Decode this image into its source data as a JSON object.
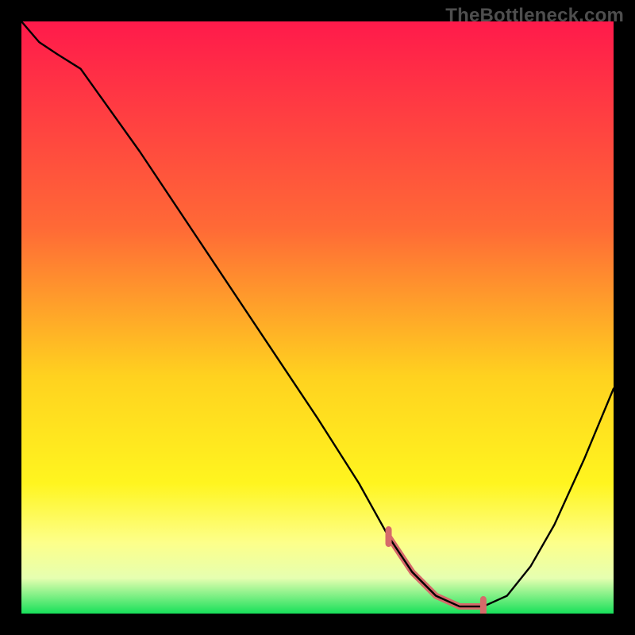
{
  "watermark": "TheBottleneck.com",
  "chart_data": {
    "type": "line",
    "title": "",
    "xlabel": "",
    "ylabel": "",
    "xlim": [
      0,
      100
    ],
    "ylim": [
      0,
      100
    ],
    "grid": false,
    "series": [
      {
        "name": "curve",
        "x": [
          0,
          3,
          6,
          10,
          20,
          30,
          40,
          50,
          57,
          62,
          66,
          70,
          74,
          78,
          82,
          86,
          90,
          95,
          100
        ],
        "y": [
          100,
          96.5,
          94.5,
          92,
          78,
          63,
          48,
          33,
          22,
          13,
          7,
          3,
          1.2,
          1.2,
          3,
          8,
          15,
          26,
          38
        ]
      }
    ],
    "gradient_stops": [
      {
        "offset": 0,
        "color": "#ff1a4b"
      },
      {
        "offset": 35,
        "color": "#ff6a36"
      },
      {
        "offset": 60,
        "color": "#ffd21f"
      },
      {
        "offset": 78,
        "color": "#fff51f"
      },
      {
        "offset": 88,
        "color": "#fdff8a"
      },
      {
        "offset": 94,
        "color": "#e6ffb0"
      },
      {
        "offset": 100,
        "color": "#18e05a"
      }
    ],
    "marker_band": {
      "color": "#d66a6a",
      "width": 8,
      "x": [
        62,
        66,
        70,
        74,
        78
      ],
      "y": [
        13,
        7,
        3,
        1.2,
        1.2
      ]
    }
  }
}
